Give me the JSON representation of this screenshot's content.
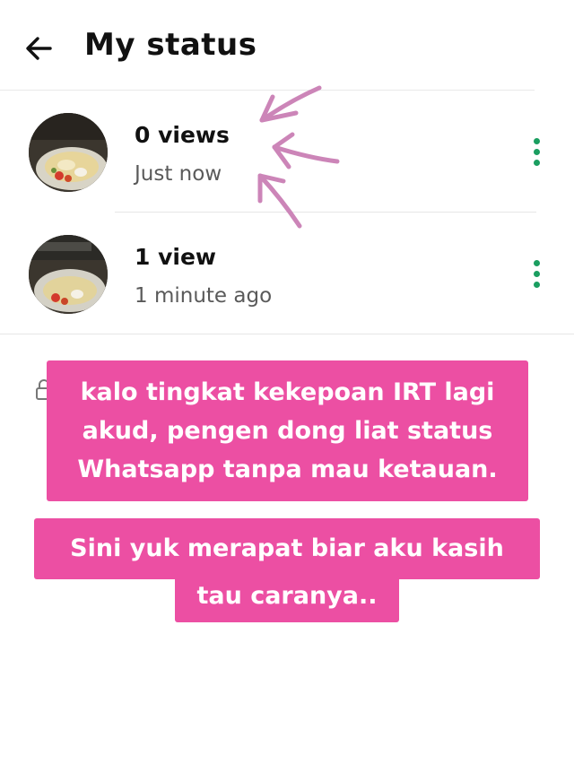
{
  "header": {
    "title": "My status"
  },
  "statuses": [
    {
      "views": "0 views",
      "time": "Just now"
    },
    {
      "views": "1 view",
      "time": "1 minute ago"
    }
  ],
  "overlay": {
    "caption_1": [
      "kalo tingkat kekepoan IRT lagi",
      "akud, pengen dong liat status",
      "Whatsapp tanpa mau ketauan."
    ],
    "caption_2": [
      "Sini yuk merapat biar aku kasih",
      "tau caranya.."
    ]
  },
  "colors": {
    "accent_green": "#1a9e60",
    "caption_bg": "#ec4fa3",
    "arrow_color": "#cc85b8"
  },
  "icons": [
    "arrow-back-icon",
    "more-vert-icon",
    "lock-icon"
  ]
}
